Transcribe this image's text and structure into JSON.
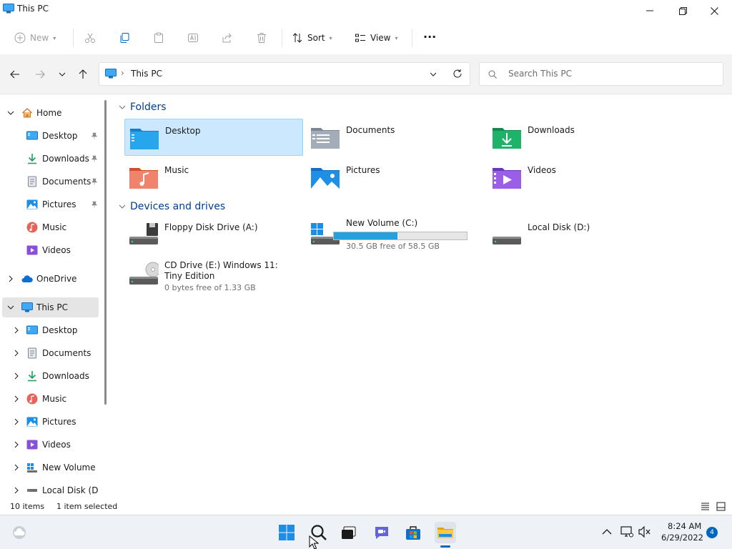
{
  "window": {
    "title": "This PC"
  },
  "toolbar": {
    "new_label": "New",
    "sort_label": "Sort",
    "view_label": "View",
    "more_label": "···"
  },
  "address": {
    "path": "This PC",
    "separator": "›",
    "search_placeholder": "Search This PC"
  },
  "nav": {
    "home": "Home",
    "quick": [
      {
        "label": "Desktop",
        "pinned": true
      },
      {
        "label": "Downloads",
        "pinned": true
      },
      {
        "label": "Documents",
        "pinned": true
      },
      {
        "label": "Pictures",
        "pinned": true
      },
      {
        "label": "Music",
        "pinned": false
      },
      {
        "label": "Videos",
        "pinned": false
      }
    ],
    "onedrive": "OneDrive",
    "thispc": "This PC",
    "pc_children": [
      "Desktop",
      "Documents",
      "Downloads",
      "Music",
      "Pictures",
      "Videos",
      "New Volume (C",
      "Local Disk (D:)"
    ]
  },
  "content": {
    "folders_header": "Folders",
    "folders": [
      "Desktop",
      "Documents",
      "Downloads",
      "Music",
      "Pictures",
      "Videos"
    ],
    "devices_header": "Devices and drives",
    "drives": [
      {
        "name": "Floppy Disk Drive (A:)"
      },
      {
        "name": "New Volume (C:)",
        "free": "30.5 GB free of 58.5 GB",
        "used_fraction": 0.48
      },
      {
        "name": "Local Disk (D:)"
      },
      {
        "name": "CD Drive (E:) Windows 11: Tiny Edition",
        "free": "0 bytes free of 1.33 GB"
      }
    ]
  },
  "status": {
    "items": "10 items",
    "selected": "1 item selected"
  },
  "taskbar": {
    "time": "8:24 AM",
    "date": "6/29/2022",
    "badge": "4"
  },
  "colors": {
    "accent": "#0067c0",
    "selection": "#cce8ff",
    "drive_bar": "#26a0da"
  }
}
